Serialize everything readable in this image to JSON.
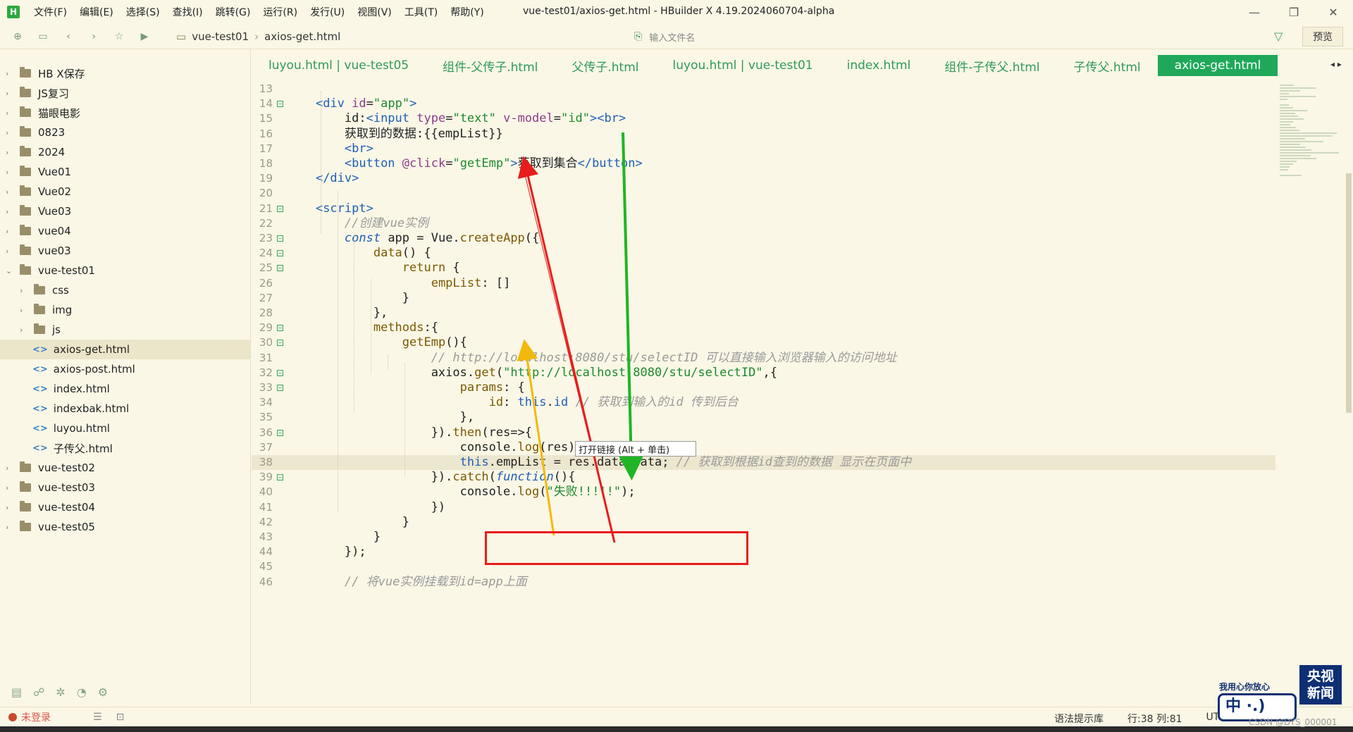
{
  "window": {
    "title": "vue-test01/axios-get.html - HBuilder X 4.19.2024060704-alpha",
    "logo": "H",
    "controls": [
      "—",
      "❐",
      "✕"
    ]
  },
  "menu": [
    "文件(F)",
    "编辑(E)",
    "选择(S)",
    "查找(I)",
    "跳转(G)",
    "运行(R)",
    "发行(U)",
    "视图(V)",
    "工具(T)",
    "帮助(Y)"
  ],
  "toolbar": {
    "breadcrumb": [
      "vue-test01",
      "axios-get.html"
    ],
    "file_search_placeholder": "输入文件名",
    "preview_label": "预览"
  },
  "sidebar": {
    "items": [
      {
        "label": "HB X保存",
        "type": "folder",
        "expanded": false
      },
      {
        "label": "JS复习",
        "type": "folder",
        "expanded": false
      },
      {
        "label": "猫眼电影",
        "type": "folder",
        "expanded": false
      },
      {
        "label": "0823",
        "type": "folder",
        "expanded": false
      },
      {
        "label": "2024",
        "type": "folder",
        "expanded": false
      },
      {
        "label": "Vue01",
        "type": "folder",
        "expanded": false
      },
      {
        "label": "Vue02",
        "type": "folder",
        "expanded": false
      },
      {
        "label": "Vue03",
        "type": "folder",
        "expanded": false
      },
      {
        "label": "vue04",
        "type": "folder",
        "expanded": false
      },
      {
        "label": "vue03",
        "type": "folder",
        "expanded": false
      },
      {
        "label": "vue-test01",
        "type": "folder",
        "expanded": true
      },
      {
        "label": "css",
        "type": "subfolder",
        "expanded": false
      },
      {
        "label": "img",
        "type": "subfolder",
        "expanded": false
      },
      {
        "label": "js",
        "type": "subfolder",
        "expanded": false
      },
      {
        "label": "axios-get.html",
        "type": "file",
        "active": true
      },
      {
        "label": "axios-post.html",
        "type": "file"
      },
      {
        "label": "index.html",
        "type": "file"
      },
      {
        "label": "indexbak.html",
        "type": "file"
      },
      {
        "label": "luyou.html",
        "type": "file"
      },
      {
        "label": "子传父.html",
        "type": "file"
      },
      {
        "label": "vue-test02",
        "type": "folder",
        "expanded": false
      },
      {
        "label": "vue-test03",
        "type": "folder",
        "expanded": false
      },
      {
        "label": "vue-test04",
        "type": "folder",
        "expanded": false
      },
      {
        "label": "vue-test05",
        "type": "folder",
        "expanded": false
      }
    ]
  },
  "tabs": [
    {
      "label": "luyou.html | vue-test05"
    },
    {
      "label": "组件-父传子.html"
    },
    {
      "label": "父传子.html"
    },
    {
      "label": "luyou.html | vue-test01"
    },
    {
      "label": "index.html"
    },
    {
      "label": "组件-子传父.html"
    },
    {
      "label": "子传父.html"
    },
    {
      "label": "axios-get.html",
      "active": true
    }
  ],
  "editor": {
    "lines": [
      {
        "n": "13",
        "fold": false,
        "segs": []
      },
      {
        "n": "14",
        "fold": true,
        "segs": [
          [
            "plain",
            "    "
          ],
          [
            "tag",
            "<div "
          ],
          [
            "attr",
            "id"
          ],
          [
            "plain",
            "="
          ],
          [
            "str",
            "\"app\""
          ],
          [
            "tag",
            ">"
          ]
        ]
      },
      {
        "n": "15",
        "fold": false,
        "segs": [
          [
            "plain",
            "        id:"
          ],
          [
            "tag",
            "<input "
          ],
          [
            "attr",
            "type"
          ],
          [
            "plain",
            "="
          ],
          [
            "str",
            "\"text\" "
          ],
          [
            "attr",
            "v-model"
          ],
          [
            "plain",
            "="
          ],
          [
            "str",
            "\"id\""
          ],
          [
            "tag",
            "><br>"
          ]
        ]
      },
      {
        "n": "16",
        "fold": false,
        "segs": [
          [
            "plain",
            "        获取到的数据:{{empList}}"
          ]
        ]
      },
      {
        "n": "17",
        "fold": false,
        "segs": [
          [
            "plain",
            "        "
          ],
          [
            "tag",
            "<br>"
          ]
        ]
      },
      {
        "n": "18",
        "fold": false,
        "segs": [
          [
            "plain",
            "        "
          ],
          [
            "tag",
            "<button "
          ],
          [
            "attr",
            "@click"
          ],
          [
            "plain",
            "="
          ],
          [
            "str",
            "\"getEmp\""
          ],
          [
            "tag",
            ">"
          ],
          [
            "plain",
            "获取到集合"
          ],
          [
            "tag",
            "</button>"
          ]
        ]
      },
      {
        "n": "19",
        "fold": false,
        "segs": [
          [
            "plain",
            "    "
          ],
          [
            "tag",
            "</div>"
          ]
        ]
      },
      {
        "n": "20",
        "fold": false,
        "segs": []
      },
      {
        "n": "21",
        "fold": true,
        "segs": [
          [
            "plain",
            "    "
          ],
          [
            "tag",
            "<script>"
          ]
        ]
      },
      {
        "n": "22",
        "fold": false,
        "segs": [
          [
            "plain",
            "        "
          ],
          [
            "cmt",
            "//创建vue实例"
          ]
        ]
      },
      {
        "n": "23",
        "fold": true,
        "segs": [
          [
            "plain",
            "        "
          ],
          [
            "kw",
            "const "
          ],
          [
            "plain",
            "app = Vue."
          ],
          [
            "fn",
            "createApp"
          ],
          [
            "plain",
            "({"
          ]
        ]
      },
      {
        "n": "24",
        "fold": true,
        "segs": [
          [
            "plain",
            "            "
          ],
          [
            "fn",
            "data"
          ],
          [
            "plain",
            "() {"
          ]
        ]
      },
      {
        "n": "25",
        "fold": true,
        "segs": [
          [
            "plain",
            "                "
          ],
          [
            "fn",
            "return"
          ],
          [
            "plain",
            " {"
          ]
        ]
      },
      {
        "n": "26",
        "fold": false,
        "segs": [
          [
            "plain",
            "                    "
          ],
          [
            "prop",
            "empList"
          ],
          [
            "plain",
            ": []"
          ]
        ]
      },
      {
        "n": "27",
        "fold": false,
        "segs": [
          [
            "plain",
            "                }"
          ]
        ]
      },
      {
        "n": "28",
        "fold": false,
        "segs": [
          [
            "plain",
            "            },"
          ]
        ]
      },
      {
        "n": "29",
        "fold": true,
        "segs": [
          [
            "plain",
            "            "
          ],
          [
            "prop",
            "methods"
          ],
          [
            "plain",
            ":{"
          ]
        ]
      },
      {
        "n": "30",
        "fold": true,
        "segs": [
          [
            "plain",
            "                "
          ],
          [
            "fn",
            "getEmp"
          ],
          [
            "plain",
            "(){"
          ]
        ]
      },
      {
        "n": "31",
        "fold": false,
        "segs": [
          [
            "plain",
            "                    "
          ],
          [
            "cmt",
            "// http://localhost:8080/stu/selectID 可以直接输入浏览器输入的访问地址"
          ]
        ]
      },
      {
        "n": "32",
        "fold": true,
        "segs": [
          [
            "plain",
            "                    axios."
          ],
          [
            "fn",
            "get"
          ],
          [
            "plain",
            "("
          ],
          [
            "str",
            "\"http://localhost:8080/stu/selectID\""
          ],
          [
            "plain",
            ",{"
          ]
        ]
      },
      {
        "n": "33",
        "fold": true,
        "segs": [
          [
            "plain",
            "                        "
          ],
          [
            "prop",
            "params"
          ],
          [
            "plain",
            ": {"
          ]
        ]
      },
      {
        "n": "34",
        "fold": false,
        "segs": [
          [
            "plain",
            "                            "
          ],
          [
            "prop",
            "id"
          ],
          [
            "plain",
            ": "
          ],
          [
            "tag",
            "this"
          ],
          [
            "plain",
            "."
          ],
          [
            "tag",
            "id "
          ],
          [
            "cmt",
            "// 获取到输入的id 传到后台"
          ]
        ]
      },
      {
        "n": "35",
        "fold": false,
        "segs": [
          [
            "plain",
            "                        },"
          ]
        ]
      },
      {
        "n": "36",
        "fold": true,
        "segs": [
          [
            "plain",
            "                    })."
          ],
          [
            "fn",
            "then"
          ],
          [
            "plain",
            "(res=>{"
          ]
        ]
      },
      {
        "n": "37",
        "fold": false,
        "segs": [
          [
            "plain",
            "                        console."
          ],
          [
            "fn",
            "log"
          ],
          [
            "plain",
            "(res);"
          ]
        ]
      },
      {
        "n": "38",
        "fold": false,
        "hl": true,
        "segs": [
          [
            "plain",
            "                        "
          ],
          [
            "tag",
            "this"
          ],
          [
            "plain",
            ".empList = res.data.data; "
          ],
          [
            "cmt",
            "// 获取到根据id查到的数据 显示在页面中"
          ]
        ]
      },
      {
        "n": "39",
        "fold": true,
        "segs": [
          [
            "plain",
            "                    })."
          ],
          [
            "fn",
            "catch"
          ],
          [
            "plain",
            "("
          ],
          [
            "kw",
            "function"
          ],
          [
            "plain",
            "(){"
          ]
        ]
      },
      {
        "n": "40",
        "fold": false,
        "segs": [
          [
            "plain",
            "                        console."
          ],
          [
            "fn",
            "log"
          ],
          [
            "plain",
            "("
          ],
          [
            "str",
            "\"失败!!!!!\""
          ],
          [
            "plain",
            ");"
          ]
        ]
      },
      {
        "n": "41",
        "fold": false,
        "segs": [
          [
            "plain",
            "                    })"
          ]
        ]
      },
      {
        "n": "42",
        "fold": false,
        "segs": [
          [
            "plain",
            "                }"
          ]
        ]
      },
      {
        "n": "43",
        "fold": false,
        "segs": [
          [
            "plain",
            "            }"
          ]
        ]
      },
      {
        "n": "44",
        "fold": false,
        "segs": [
          [
            "plain",
            "        });"
          ]
        ]
      },
      {
        "n": "45",
        "fold": false,
        "segs": []
      },
      {
        "n": "46",
        "fold": false,
        "segs": [
          [
            "plain",
            "        "
          ],
          [
            "cmt",
            "// 将vue实例挂载到id=app上面"
          ]
        ]
      }
    ]
  },
  "tooltip": "打开链接 (Alt + 单击)",
  "status": {
    "login": "未登录",
    "syntax_lib": "语法提示库",
    "position": "行:38 列:81",
    "encoding": "UT"
  },
  "watermark": {
    "cctv_line1": "央视",
    "cctv_line2": "新闻",
    "slogan": "我用心你放心",
    "zh": "中 ·.)",
    "csdn": "CSDN @DYS_000001"
  },
  "colors": {
    "accent": "#1fa85a",
    "annotation_red": "#e81c1c",
    "annotation_green": "#1fb526",
    "annotation_yellow": "#f2b90c",
    "background": "#faf7e6"
  }
}
